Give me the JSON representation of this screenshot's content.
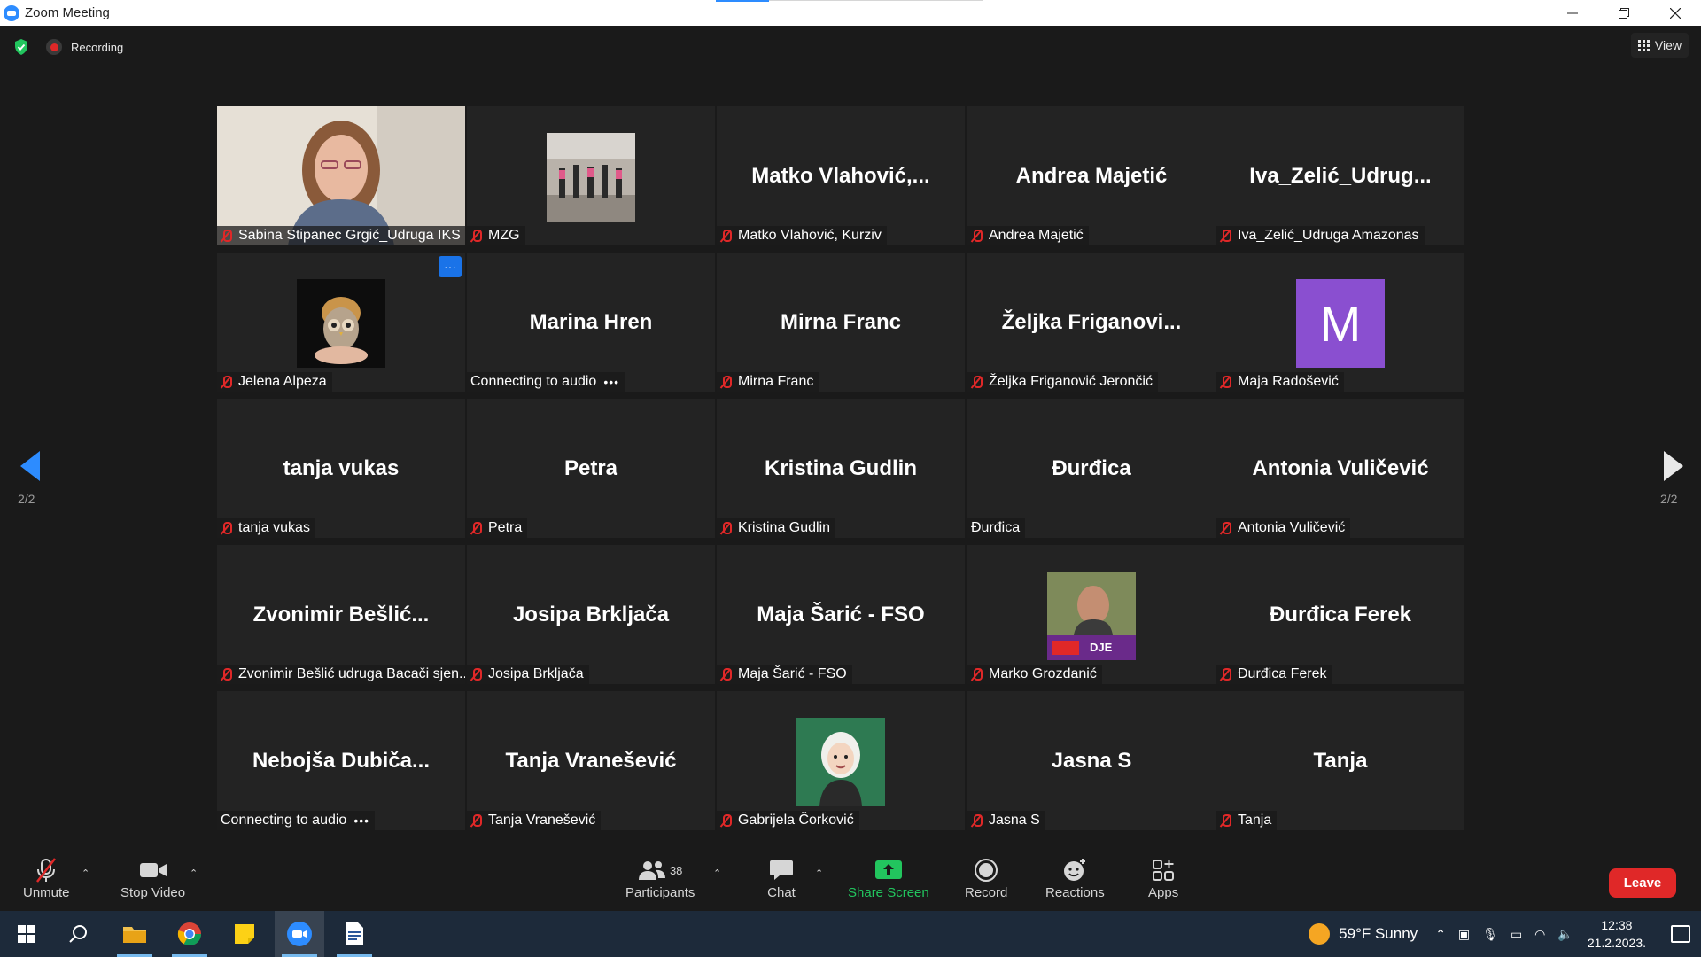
{
  "window": {
    "title": "Zoom Meeting"
  },
  "status": {
    "recording_label": "Recording"
  },
  "view_button": {
    "label": "View"
  },
  "pager": {
    "left_page": "2/2",
    "right_page": "2/2"
  },
  "tiles": [
    {
      "big_name": "",
      "label": "Sabina Stipanec Grgić_Udruga IKS",
      "muted": true,
      "kind": "photo-sabina"
    },
    {
      "big_name": "",
      "label": "MZG",
      "muted": true,
      "kind": "image-dance"
    },
    {
      "big_name": "Matko  Vlahović,...",
      "label": "Matko Vlahović, Kurziv",
      "muted": true
    },
    {
      "big_name": "Andrea Majetić",
      "label": "Andrea Majetić",
      "muted": true
    },
    {
      "big_name": "Iva_Zelić_Udrug...",
      "label": "Iva_Zelić_Udruga Amazonas",
      "muted": true
    },
    {
      "big_name": "",
      "label": "Jelena Alpeza",
      "muted": true,
      "kind": "image-owl",
      "more": "···"
    },
    {
      "big_name": "Marina Hren",
      "label": "Connecting to audio",
      "muted": false,
      "connecting": true
    },
    {
      "big_name": "Mirna Franc",
      "label": "Mirna Franc",
      "muted": true
    },
    {
      "big_name": "Željka  Friganovi...",
      "label": "Željka Friganović Jerončić",
      "muted": true
    },
    {
      "big_name": "",
      "label": "Maja Radošević",
      "muted": true,
      "kind": "avatar-m",
      "avatar_letter": "M"
    },
    {
      "big_name": "tanja vukas",
      "label": "tanja vukas",
      "muted": true
    },
    {
      "big_name": "Petra",
      "label": "Petra",
      "muted": true
    },
    {
      "big_name": "Kristina Gudlin",
      "label": "Kristina Gudlin",
      "muted": true
    },
    {
      "big_name": "Đurđica",
      "label": "Đurđica",
      "muted": false
    },
    {
      "big_name": "Antonia Vuličević",
      "label": "Antonia Vuličević",
      "muted": true
    },
    {
      "big_name": "Zvonimir  Bešlić...",
      "label": "Zvonimir Bešlić udruga Bacači sjen...",
      "muted": true
    },
    {
      "big_name": "Josipa Brkljača",
      "label": "Josipa Brkljača",
      "muted": true
    },
    {
      "big_name": "Maja Šarić - FSO",
      "label": "Maja Šarić - FSO",
      "muted": true
    },
    {
      "big_name": "",
      "label": "Marko Grozdanić",
      "muted": true,
      "kind": "image-marko"
    },
    {
      "big_name": "Đurđica Ferek",
      "label": "Đurđica Ferek",
      "muted": true
    },
    {
      "big_name": "Nebojša  Dubiča...",
      "label": "Connecting to audio",
      "muted": false,
      "connecting": true
    },
    {
      "big_name": "Tanja Vranešević",
      "label": "Tanja Vranešević",
      "muted": true
    },
    {
      "big_name": "",
      "label": "Gabrijela Čorković",
      "muted": true,
      "kind": "image-gabrijela"
    },
    {
      "big_name": "Jasna S",
      "label": "Jasna S",
      "muted": true
    },
    {
      "big_name": "Tanja",
      "label": "Tanja",
      "muted": true
    }
  ],
  "toolbar": {
    "unmute": "Unmute",
    "stop_video": "Stop Video",
    "participants": "Participants",
    "participants_count": "38",
    "chat": "Chat",
    "share_screen": "Share Screen",
    "record": "Record",
    "reactions": "Reactions",
    "apps": "Apps",
    "leave": "Leave"
  },
  "taskbar": {
    "weather": "59°F  Sunny",
    "time": "12:38",
    "date": "21.2.2023."
  },
  "colors": {
    "accent": "#2d8cff",
    "muted_red": "#e02828",
    "share_green": "#22c55e",
    "leave_red": "#e02828",
    "avatar_purple": "#8a4fd0"
  }
}
